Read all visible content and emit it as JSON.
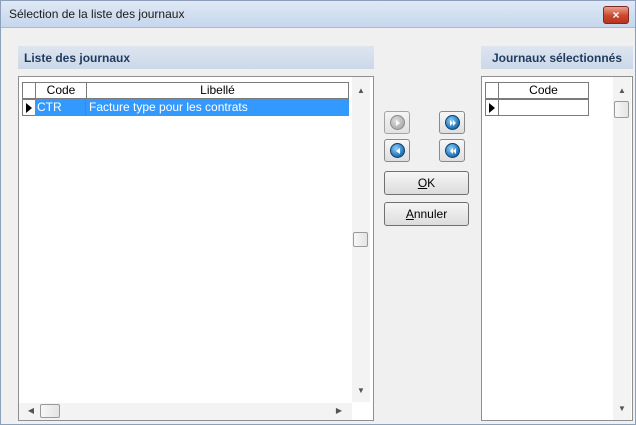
{
  "window": {
    "title": "Sélection de la liste des journaux",
    "close_glyph": "×"
  },
  "left_panel": {
    "header": "Liste des journaux",
    "columns": [
      "Code",
      "Libellé"
    ],
    "rows": [
      {
        "code": "CTR",
        "libelle": "Facture type pour les contrats",
        "selected": true
      }
    ]
  },
  "right_panel": {
    "header": "Journaux sélectionnés",
    "columns": [
      "Code"
    ],
    "rows": [
      {
        "code": ""
      }
    ]
  },
  "buttons": {
    "ok_mnemonic": "O",
    "ok_rest": "K",
    "cancel_mnemonic": "A",
    "cancel_rest": "nnuler"
  },
  "icons": {
    "nav_add_one": "arrow-right-icon",
    "nav_add_all": "double-arrow-right-icon",
    "nav_remove_one": "arrow-left-icon",
    "nav_remove_all": "double-arrow-left-icon"
  },
  "colors": {
    "selection": "#3399ff",
    "header_text": "#1f3a5d",
    "close_button": "#c9472c"
  }
}
